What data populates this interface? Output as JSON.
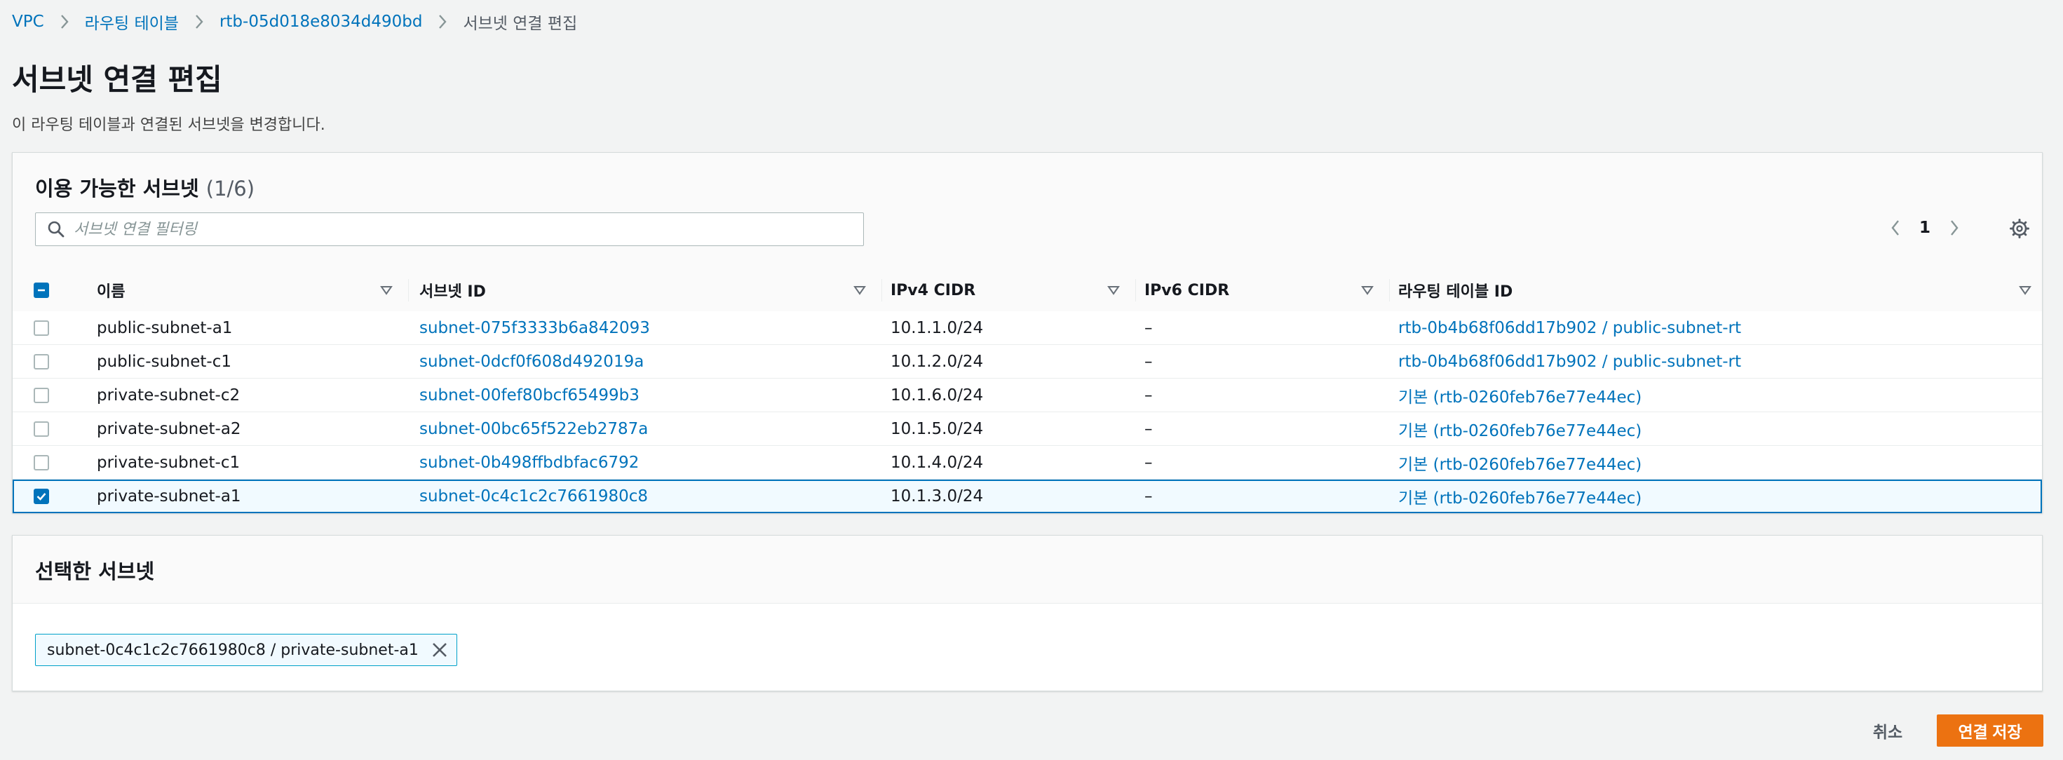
{
  "breadcrumb": {
    "items": [
      "VPC",
      "라우팅 테이블",
      "rtb-05d018e8034d490bd",
      "서브넷 연결 편집"
    ]
  },
  "page": {
    "title": "서브넷 연결 편집",
    "description": "이 라우팅 테이블과 연결된 서브넷을 변경합니다."
  },
  "available_panel": {
    "title": "이용 가능한 서브넷",
    "count": "(1/6)",
    "search_placeholder": "서브넷 연결 필터링",
    "page_number": "1",
    "columns": [
      "이름",
      "서브넷 ID",
      "IPv4 CIDR",
      "IPv6 CIDR",
      "라우팅 테이블 ID"
    ],
    "rows": [
      {
        "name": "public-subnet-a1",
        "subnet_id": "subnet-075f3333b6a842093",
        "ipv4": "10.1.1.0/24",
        "ipv6": "–",
        "route_table": "rtb-0b4b68f06dd17b902 / public-subnet-rt",
        "checked": false
      },
      {
        "name": "public-subnet-c1",
        "subnet_id": "subnet-0dcf0f608d492019a",
        "ipv4": "10.1.2.0/24",
        "ipv6": "–",
        "route_table": "rtb-0b4b68f06dd17b902 / public-subnet-rt",
        "checked": false
      },
      {
        "name": "private-subnet-c2",
        "subnet_id": "subnet-00fef80bcf65499b3",
        "ipv4": "10.1.6.0/24",
        "ipv6": "–",
        "route_table": "기본 (rtb-0260feb76e77e44ec)",
        "checked": false
      },
      {
        "name": "private-subnet-a2",
        "subnet_id": "subnet-00bc65f522eb2787a",
        "ipv4": "10.1.5.0/24",
        "ipv6": "–",
        "route_table": "기본 (rtb-0260feb76e77e44ec)",
        "checked": false
      },
      {
        "name": "private-subnet-c1",
        "subnet_id": "subnet-0b498ffbdbfac6792",
        "ipv4": "10.1.4.0/24",
        "ipv6": "–",
        "route_table": "기본 (rtb-0260feb76e77e44ec)",
        "checked": false
      },
      {
        "name": "private-subnet-a1",
        "subnet_id": "subnet-0c4c1c2c7661980c8",
        "ipv4": "10.1.3.0/24",
        "ipv6": "–",
        "route_table": "기본 (rtb-0260feb76e77e44ec)",
        "checked": true
      }
    ]
  },
  "selected_panel": {
    "title": "선택한 서브넷",
    "token": "subnet-0c4c1c2c7661980c8 / private-subnet-a1"
  },
  "footer": {
    "cancel_label": "취소",
    "save_label": "연결 저장"
  },
  "colors": {
    "link": "#0073bb",
    "primary_button": "#ec7211",
    "selected_row_bg": "#f1faff"
  },
  "icons": [
    "chevron-right-icon",
    "search-icon",
    "chevron-left-icon",
    "gear-icon",
    "sort-caret-icon",
    "close-icon",
    "checkmark-icon",
    "minus-icon"
  ]
}
